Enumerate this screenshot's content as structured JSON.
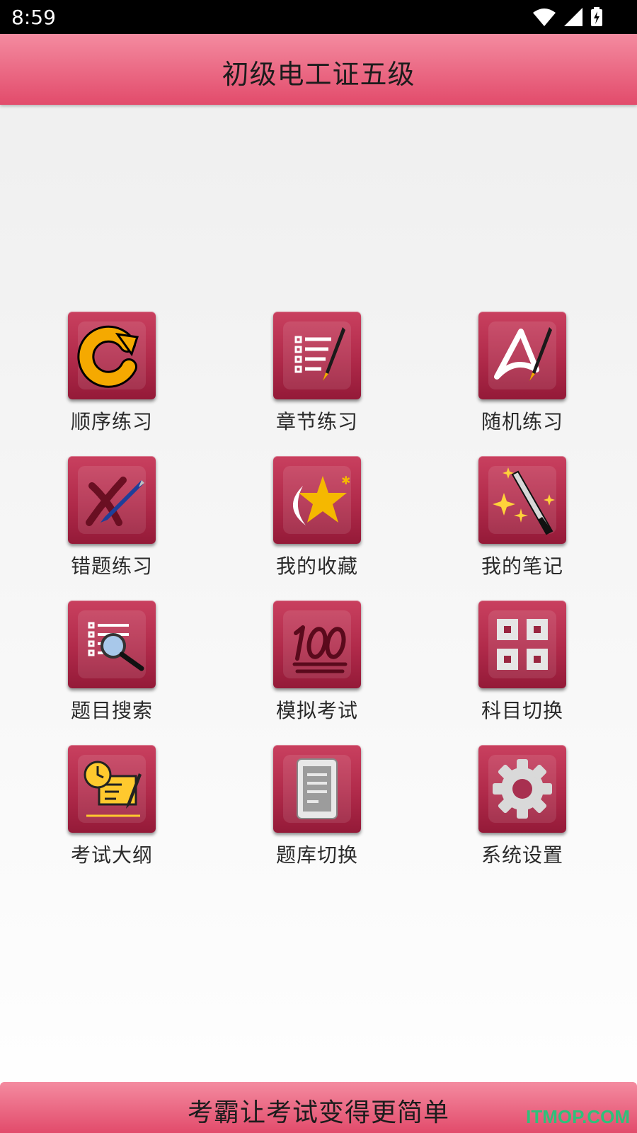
{
  "status_bar": {
    "time": "8:59",
    "icons": [
      "wifi-icon",
      "cellular-signal-icon",
      "battery-charging-icon"
    ]
  },
  "app_bar": {
    "title": "初级电工证五级"
  },
  "menu": [
    {
      "label": "顺序练习",
      "icon": "circular-arrow-icon"
    },
    {
      "label": "章节练习",
      "icon": "list-with-pen-icon"
    },
    {
      "label": "随机练习",
      "icon": "triangle-with-pen-icon"
    },
    {
      "label": "错题练习",
      "icon": "cross-with-pen-icon"
    },
    {
      "label": "我的收藏",
      "icon": "star-icon"
    },
    {
      "label": "我的笔记",
      "icon": "magic-wand-icon"
    },
    {
      "label": "题目搜索",
      "icon": "list-magnifier-icon"
    },
    {
      "label": "模拟考试",
      "icon": "hundred-points-icon"
    },
    {
      "label": "科目切换",
      "icon": "grid-squares-icon"
    },
    {
      "label": "考试大纲",
      "icon": "clock-document-icon"
    },
    {
      "label": "题库切换",
      "icon": "document-icon"
    },
    {
      "label": "系统设置",
      "icon": "gear-icon"
    }
  ],
  "bottom_bar": {
    "slogan": "考霸让考试变得更简单"
  },
  "watermark": "ITMOP.COM",
  "colors": {
    "app_bar": "#e75b78",
    "tile": "#b02a4a",
    "accent_yellow": "#f5a900",
    "watermark": "#2fc07a"
  }
}
